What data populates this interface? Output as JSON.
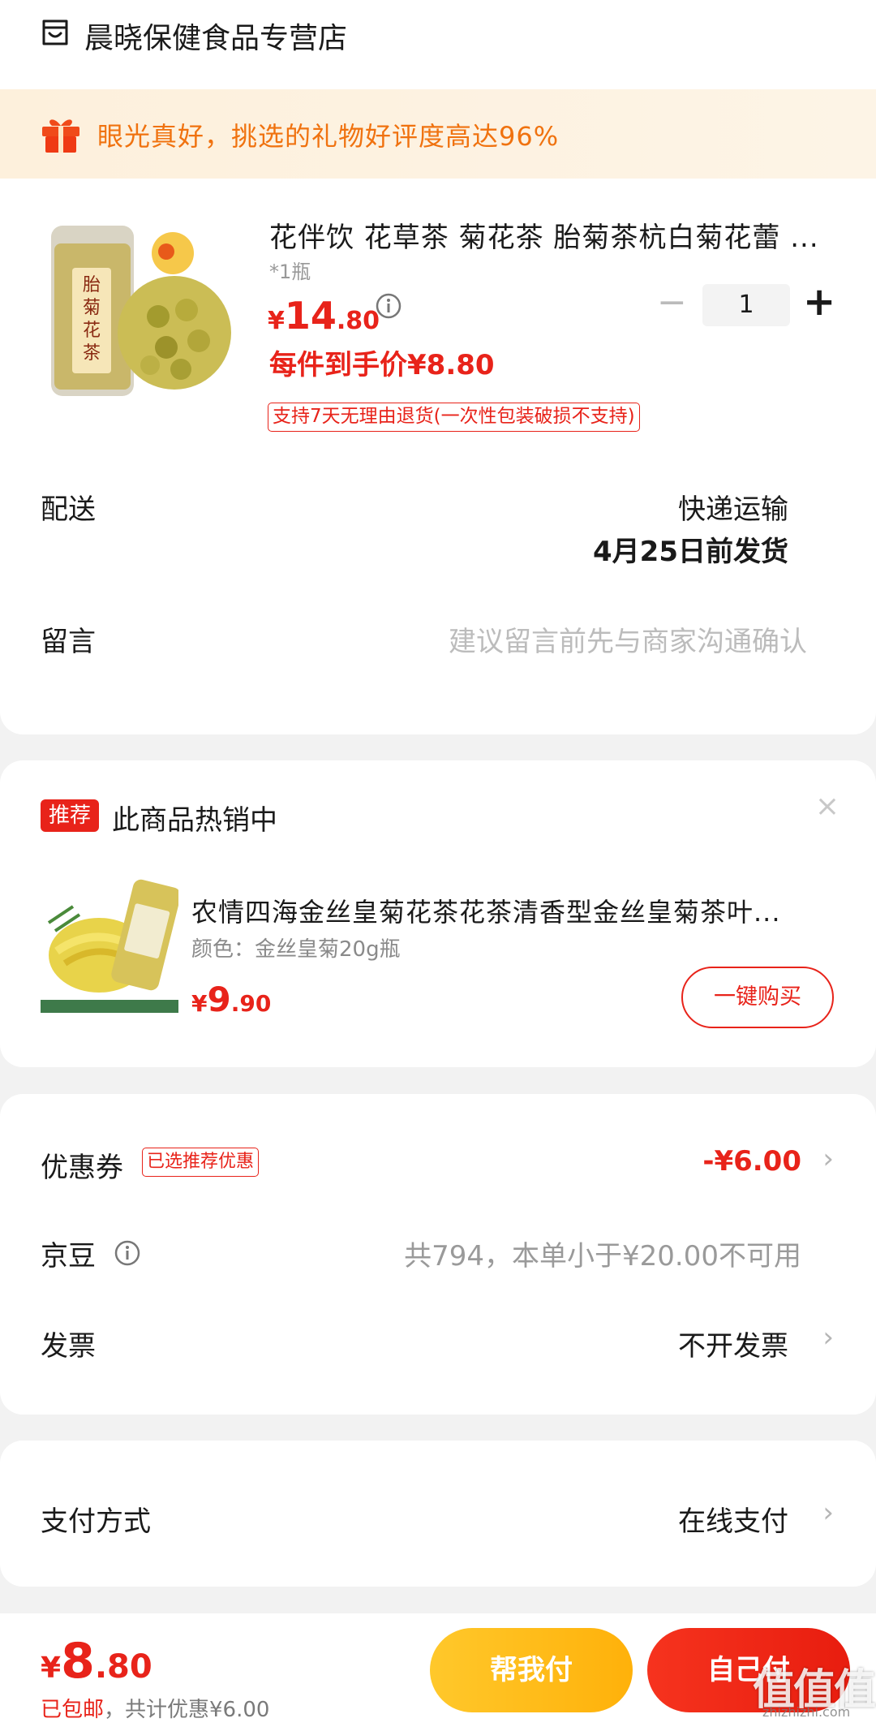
{
  "shop": {
    "name": "晨晓保健食品专营店"
  },
  "gift_banner": {
    "text": "眼光真好，挑选的礼物好评度高达96%"
  },
  "product": {
    "title": "花伴饮 花草茶 菊花茶 胎菊茶杭白菊花蕾 ...",
    "spec": "*1瓶",
    "price_yen": "¥",
    "price_int": "14",
    "price_dec": ".80",
    "quantity": "1",
    "qty_minus": "−",
    "qty_plus": "+",
    "hand_price": "每件到手价¥8.80",
    "return_policy": "支持7天无理由退货(一次性包装破损不支持)"
  },
  "delivery": {
    "label": "配送",
    "method": "快递运输",
    "date": "4月25日前发货"
  },
  "note": {
    "label": "留言",
    "placeholder": "建议留言前先与商家沟通确认"
  },
  "recommend": {
    "badge": "推荐",
    "title": "此商品热销中",
    "close": "×",
    "name": "农情四海金丝皇菊花茶花茶清香型金丝皇菊茶叶...",
    "color": "颜色：金丝皇菊20g瓶",
    "price_yen": "¥",
    "price_int": "9",
    "price_dec": ".90",
    "buy_label": "一键购买"
  },
  "coupon": {
    "label": "优惠券",
    "tag": "已选推荐优惠",
    "value": "-¥6.00"
  },
  "jingdou": {
    "label": "京豆",
    "text": "共794，本单小于¥20.00不可用"
  },
  "invoice": {
    "label": "发票",
    "value": "不开发票"
  },
  "payment": {
    "label": "支付方式",
    "value": "在线支付"
  },
  "bottom": {
    "price_yen": "¥",
    "price_int": "8",
    "price_dec": ".80",
    "shipping": "已包邮",
    "discount_note": "，共计优惠¥6.00",
    "helper_label": "帮我付",
    "self_label": "自己付"
  },
  "watermark": {
    "text": "值值值",
    "site": "zhizhizhi.com"
  },
  "chevron": "›",
  "colors": {
    "accent_red": "#e8231a",
    "gift_orange": "#f0720f",
    "helper_yellow": "#ffc82b"
  }
}
